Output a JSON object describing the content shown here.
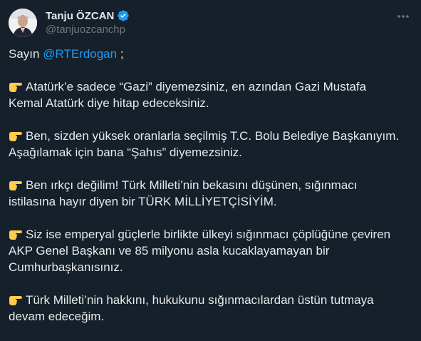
{
  "author": {
    "display_name": "Tanju ÖZCAN",
    "handle": "@tanjuozcanchp"
  },
  "icons": {
    "avatar": "profile-photo",
    "verified": "verified-badge-icon",
    "more": "more-options-icon",
    "bullet": "backhand-index-pointing-right-emoji"
  },
  "colors": {
    "background": "#15202b",
    "text": "#e7e9ea",
    "secondary_text": "#71767b",
    "accent": "#1d9bf0"
  },
  "tweet": {
    "greeting_prefix": "Sayın ",
    "mention": "@RTErdogan",
    "greeting_suffix": " ;",
    "line1a": "Atatürk’e sadece “Gazi” diyemezsiniz, en azından Gazi Mustafa",
    "line1b": "Kemal Atatürk diye hitap edeceksiniz.",
    "line2a": "Ben, sizden yüksek oranlarla seçilmiş T.C. Bolu Belediye Başkanıyım.",
    "line2b": "Aşağılamak için bana “Şahıs” diyemezsiniz.",
    "line3a": "Ben ırkçı değilim! Türk Milleti’nin bekasını düşünen, sığınmacı",
    "line3b": "istilasına hayır diyen bir TÜRK MİLLİYETÇİSİYİM.",
    "line4a": "Siz ise emperyal güçlerle birlikte ülkeyi sığınmacı çöplüğüne çeviren",
    "line4b": "AKP Genel Başkanı ve 85 milyonu asla kucaklayamayan bir",
    "line4c": "Cumhurbaşkanısınız.",
    "line5a": "Türk Milleti’nin hakkını, hukukunu sığınmacılardan üstün tutmaya",
    "line5b": "devam edeceğim."
  }
}
